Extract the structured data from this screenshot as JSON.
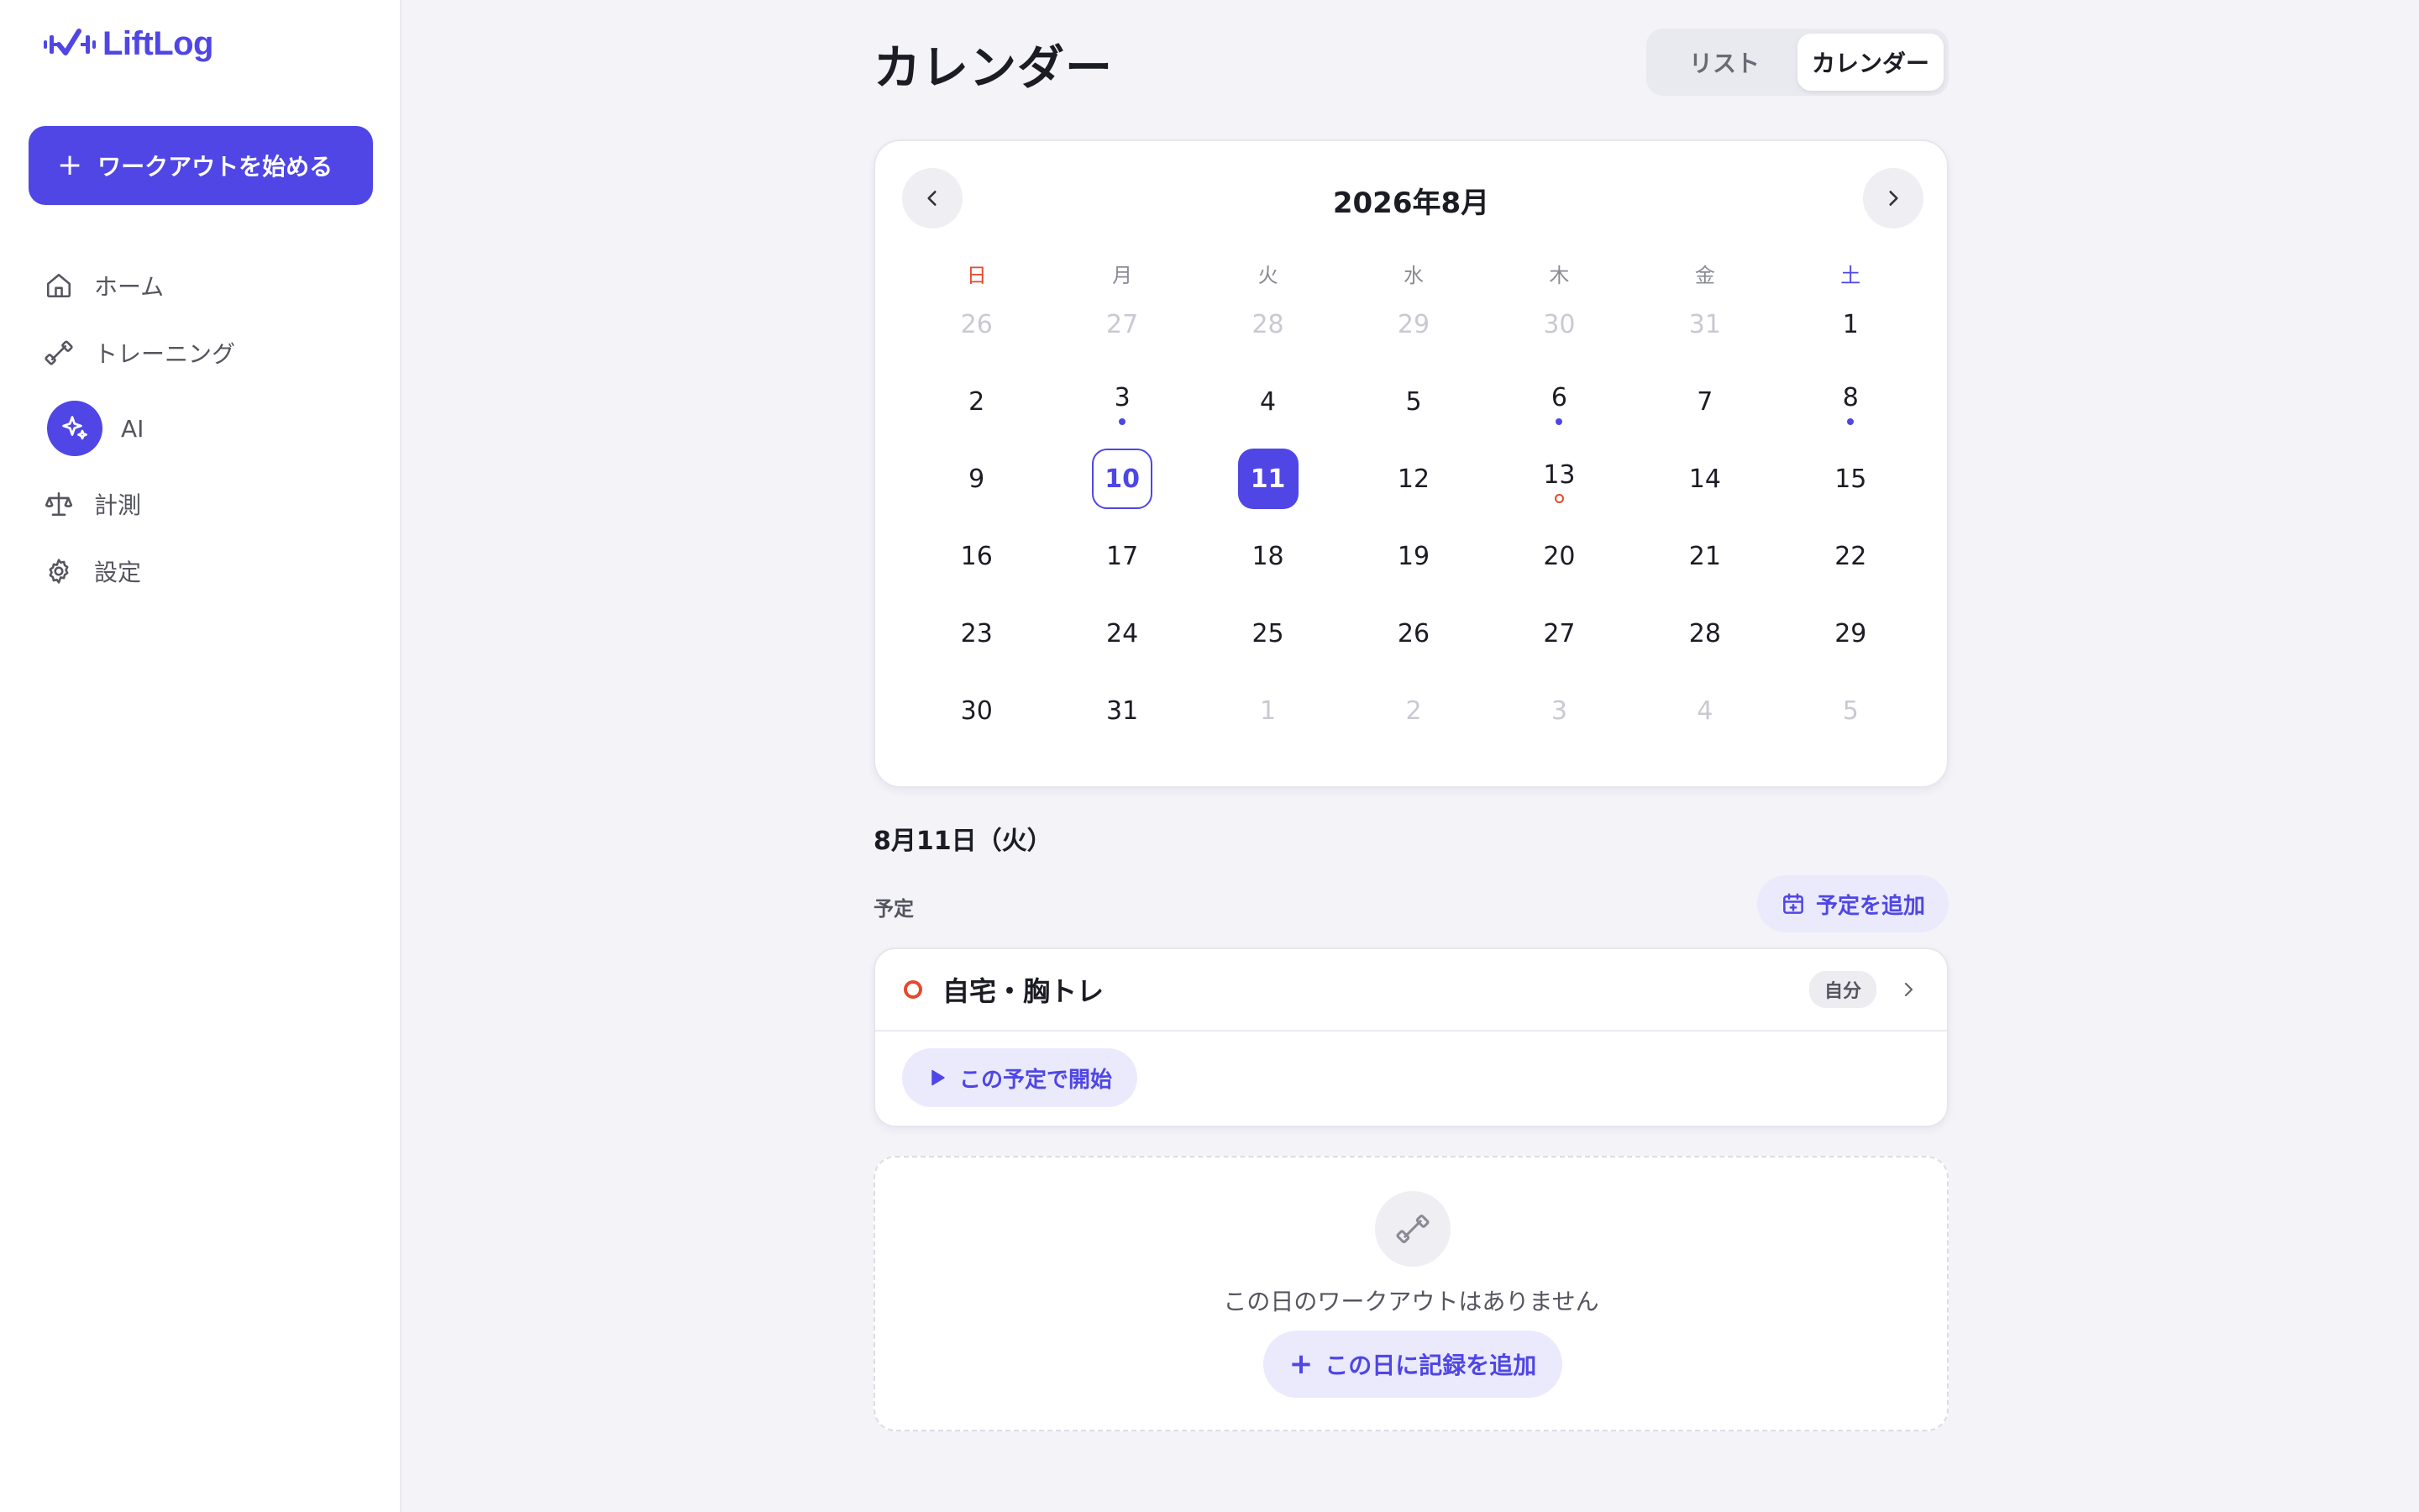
{
  "app": {
    "name": "LiftLog"
  },
  "sidebar": {
    "start_button": "ワークアウトを始める",
    "items": [
      {
        "label": "ホーム",
        "icon": "home-icon"
      },
      {
        "label": "トレーニング",
        "icon": "dumbbell-icon"
      },
      {
        "label": "AI",
        "icon": "sparkles-icon"
      },
      {
        "label": "計測",
        "icon": "scale-icon"
      },
      {
        "label": "設定",
        "icon": "gear-icon"
      }
    ]
  },
  "header": {
    "title": "カレンダー",
    "view_toggle": {
      "list": "リスト",
      "calendar": "カレンダー",
      "active": "calendar"
    }
  },
  "calendar": {
    "month_label": "2026年8月",
    "weekdays": [
      "日",
      "月",
      "火",
      "水",
      "木",
      "金",
      "土"
    ],
    "days": [
      {
        "n": "26",
        "muted": true
      },
      {
        "n": "27",
        "muted": true
      },
      {
        "n": "28",
        "muted": true
      },
      {
        "n": "29",
        "muted": true
      },
      {
        "n": "30",
        "muted": true
      },
      {
        "n": "31",
        "muted": true
      },
      {
        "n": "1"
      },
      {
        "n": "2"
      },
      {
        "n": "3",
        "dot": "solid"
      },
      {
        "n": "4"
      },
      {
        "n": "5"
      },
      {
        "n": "6",
        "dot": "solid"
      },
      {
        "n": "7"
      },
      {
        "n": "8",
        "dot": "solid"
      },
      {
        "n": "9"
      },
      {
        "n": "10",
        "today": true
      },
      {
        "n": "11",
        "selected": true
      },
      {
        "n": "12"
      },
      {
        "n": "13",
        "dot": "ring"
      },
      {
        "n": "14"
      },
      {
        "n": "15"
      },
      {
        "n": "16"
      },
      {
        "n": "17"
      },
      {
        "n": "18"
      },
      {
        "n": "19"
      },
      {
        "n": "20"
      },
      {
        "n": "21"
      },
      {
        "n": "22"
      },
      {
        "n": "23"
      },
      {
        "n": "24"
      },
      {
        "n": "25"
      },
      {
        "n": "26"
      },
      {
        "n": "27"
      },
      {
        "n": "28"
      },
      {
        "n": "29"
      },
      {
        "n": "30"
      },
      {
        "n": "31"
      },
      {
        "n": "1",
        "muted": true
      },
      {
        "n": "2",
        "muted": true
      },
      {
        "n": "3",
        "muted": true
      },
      {
        "n": "4",
        "muted": true
      },
      {
        "n": "5",
        "muted": true
      }
    ]
  },
  "selected_day": {
    "heading": "8月11日（火）",
    "plans_label": "予定",
    "add_plan_button": "予定を追加",
    "plan": {
      "title": "自宅・胸トレ",
      "badge": "自分",
      "start_button": "この予定で開始"
    },
    "empty": {
      "text": "この日のワークアウトはありません",
      "add_button": "この日に記録を追加"
    }
  },
  "colors": {
    "accent": "#4f46e5",
    "sunday": "#e5492d",
    "background": "#f3f3f8"
  }
}
